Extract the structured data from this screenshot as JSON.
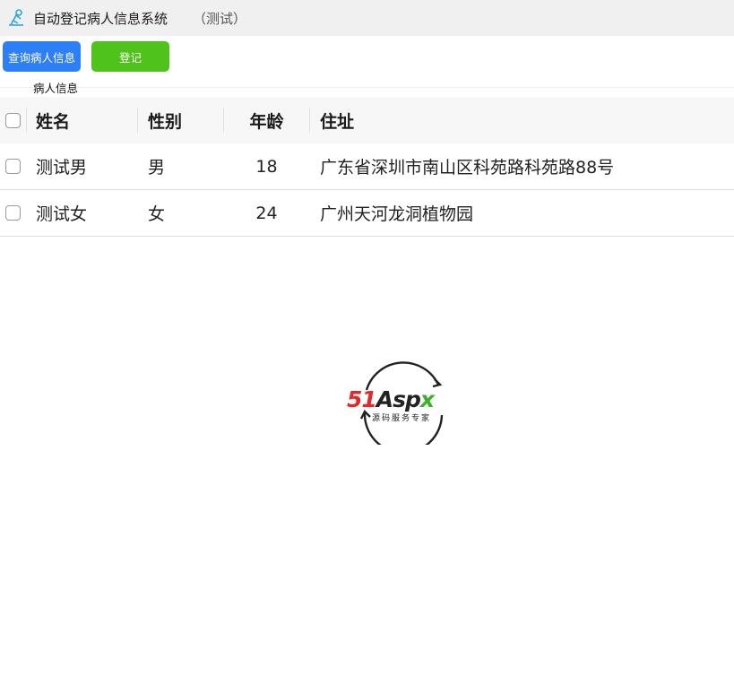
{
  "window": {
    "title": "自动登记病人信息系统",
    "subtitle": "（测试）",
    "icon": "app-icon"
  },
  "toolbar": {
    "query_label": "查询病人信息",
    "register_label": "登记",
    "query_color": "#2d7ff6",
    "register_color": "#4fc21b"
  },
  "section": {
    "label": "病人信息"
  },
  "table": {
    "columns": [
      "姓名",
      "性别",
      "年龄",
      "住址"
    ],
    "rows": [
      {
        "name": "测试男",
        "gender": "男",
        "age": "18",
        "address": "广东省深圳市南山区科苑路科苑路88号"
      },
      {
        "name": "测试女",
        "gender": "女",
        "age": "24",
        "address": "广州天河龙洞植物园"
      }
    ]
  },
  "logo": {
    "brand_51": "51",
    "brand_aspx": "Aspx",
    "tagline": "源码服务专家",
    "red": "#e02a2a",
    "dark": "#222222",
    "green": "#3cb028"
  }
}
